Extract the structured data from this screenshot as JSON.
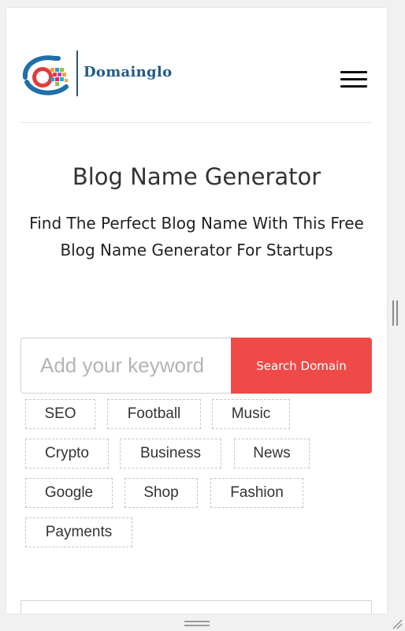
{
  "header": {
    "logo_text": "Domainglo",
    "menu_icon": "hamburger-icon"
  },
  "hero": {
    "title": "Blog Name Generator",
    "subtitle": "Find The Perfect Blog Name With This Free Blog Name Generator For Startups"
  },
  "search": {
    "placeholder": "Add your keyword",
    "value": "",
    "button_label": "Search Domain",
    "button_color": "#ef4a48"
  },
  "tags": [
    "SEO",
    "Football",
    "Music",
    "Crypto",
    "Business",
    "News",
    "Google",
    "Shop",
    "Fashion",
    "Payments"
  ],
  "colors": {
    "brand": "#1f5a86",
    "accent": "#ef4a48"
  }
}
